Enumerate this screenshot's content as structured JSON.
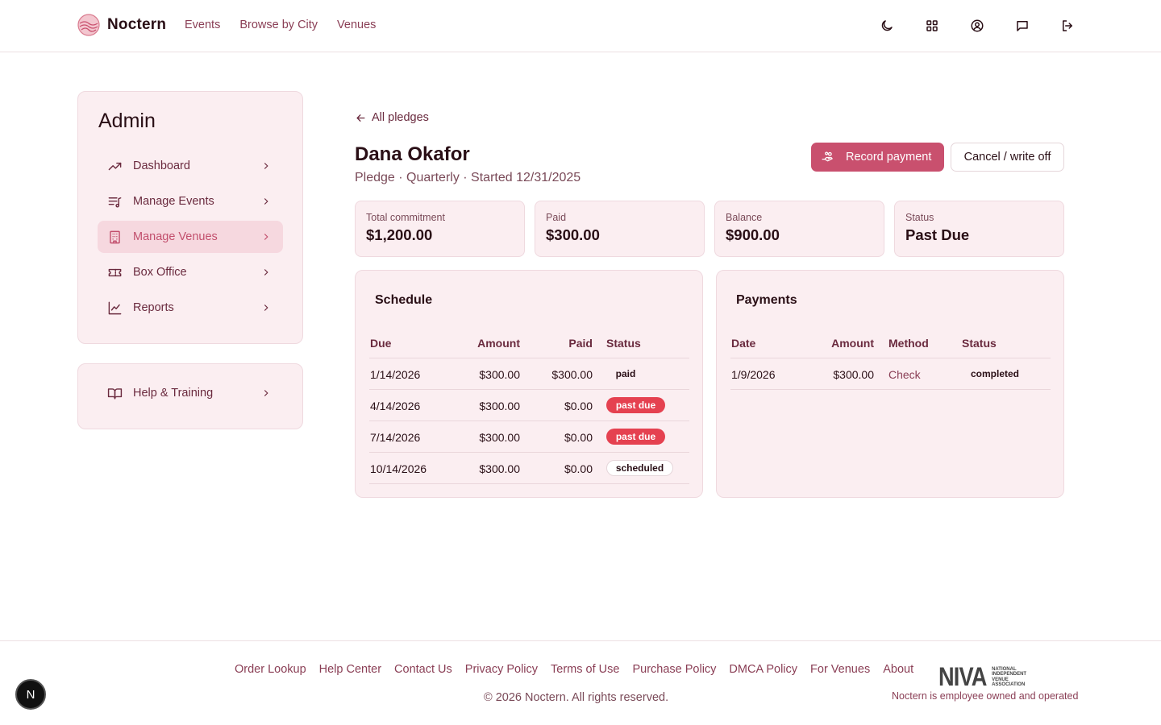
{
  "header": {
    "brand": "Noctern",
    "nav": [
      "Events",
      "Browse by City",
      "Venues"
    ],
    "icons": [
      "moon-icon",
      "grid-icon",
      "user-circle-icon",
      "message-icon",
      "logout-icon"
    ]
  },
  "sidebar": {
    "title": "Admin",
    "items": [
      {
        "label": "Dashboard",
        "icon": "trending-up-icon"
      },
      {
        "label": "Manage Events",
        "icon": "list-music-icon"
      },
      {
        "label": "Manage Venues",
        "icon": "building-icon",
        "active": true
      },
      {
        "label": "Box Office",
        "icon": "ticket-icon"
      },
      {
        "label": "Reports",
        "icon": "line-chart-icon"
      }
    ],
    "help": {
      "label": "Help & Training",
      "icon": "book-icon"
    }
  },
  "main": {
    "back_label": "All pledges",
    "name": "Dana Okafor",
    "subtitle": "Pledge · Quarterly · Started 12/31/2025",
    "record_payment": "Record payment",
    "cancel_write_off": "Cancel / write off",
    "stats": [
      {
        "label": "Total commitment",
        "value": "$1,200.00"
      },
      {
        "label": "Paid",
        "value": "$300.00"
      },
      {
        "label": "Balance",
        "value": "$900.00"
      },
      {
        "label": "Status",
        "value": "Past Due"
      }
    ],
    "schedule": {
      "title": "Schedule",
      "columns": [
        "Due",
        "Amount",
        "Paid",
        "Status"
      ],
      "rows": [
        {
          "due": "1/14/2026",
          "amount": "$300.00",
          "paid": "$300.00",
          "status": "paid"
        },
        {
          "due": "4/14/2026",
          "amount": "$300.00",
          "paid": "$0.00",
          "status": "past due"
        },
        {
          "due": "7/14/2026",
          "amount": "$300.00",
          "paid": "$0.00",
          "status": "past due"
        },
        {
          "due": "10/14/2026",
          "amount": "$300.00",
          "paid": "$0.00",
          "status": "scheduled"
        }
      ]
    },
    "payments": {
      "title": "Payments",
      "columns": [
        "Date",
        "Amount",
        "Method",
        "Status"
      ],
      "rows": [
        {
          "date": "1/9/2026",
          "amount": "$300.00",
          "method": "Check",
          "status": "completed"
        }
      ]
    }
  },
  "footer": {
    "links": [
      "Order Lookup",
      "Help Center",
      "Contact Us",
      "Privacy Policy",
      "Terms of Use",
      "Purchase Policy",
      "DMCA Policy",
      "For Venues",
      "About"
    ],
    "copyright": "© 2026 Noctern. All rights reserved.",
    "niva_logo": "NIVA",
    "niva_lines": [
      "NATIONAL",
      "INDEPENDENT",
      "VENUE",
      "ASSOCIATION"
    ],
    "employee_note": "Noctern is employee owned and operated"
  },
  "dev_badge": "N",
  "colors": {
    "accent": "#c9506e",
    "past_due": "#e54150",
    "card_bg": "#fbeef1",
    "active_bg": "#f6d8df"
  }
}
